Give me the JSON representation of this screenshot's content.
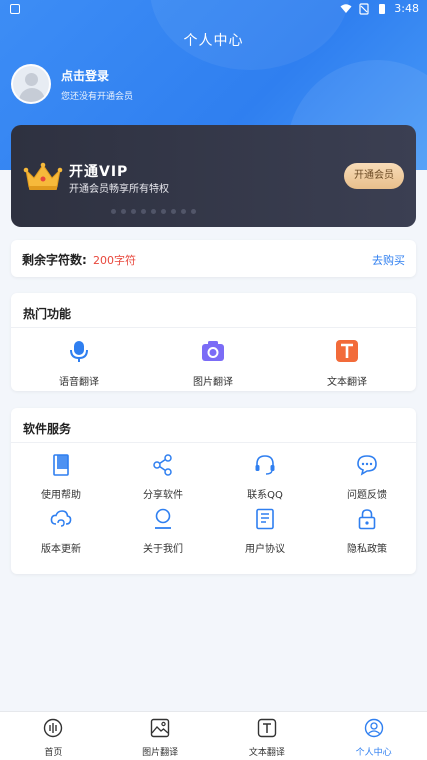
{
  "statusbar": {
    "time": "3:48"
  },
  "header": {
    "title": "个人中心"
  },
  "profile": {
    "login_label": "点击登录",
    "subtitle": "您还没有开通会员"
  },
  "vip": {
    "title": "开通VIP",
    "subtitle": "开通会员畅享所有特权",
    "button_label": "开通会员"
  },
  "chars": {
    "label": "剩余字符数:",
    "value": "200字符",
    "buy_label": "去购买"
  },
  "hot": {
    "title": "热门功能",
    "items": [
      {
        "label": "语音翻译",
        "icon": "microphone-icon"
      },
      {
        "label": "图片翻译",
        "icon": "camera-icon"
      },
      {
        "label": "文本翻译",
        "icon": "text-icon"
      }
    ]
  },
  "service": {
    "title": "软件服务",
    "items": [
      {
        "label": "使用帮助",
        "icon": "book-icon"
      },
      {
        "label": "分享软件",
        "icon": "share-icon"
      },
      {
        "label": "联系QQ",
        "icon": "headset-icon"
      },
      {
        "label": "问题反馈",
        "icon": "chat-bubble-icon"
      },
      {
        "label": "版本更新",
        "icon": "cloud-refresh-icon"
      },
      {
        "label": "关于我们",
        "icon": "person-icon"
      },
      {
        "label": "用户协议",
        "icon": "document-icon"
      },
      {
        "label": "隐私政策",
        "icon": "lock-icon"
      }
    ]
  },
  "tabbar": {
    "items": [
      {
        "label": "首页",
        "icon": "home-icon",
        "active": false
      },
      {
        "label": "图片翻译",
        "icon": "image-icon",
        "active": false
      },
      {
        "label": "文本翻译",
        "icon": "text-icon",
        "active": false
      },
      {
        "label": "个人中心",
        "icon": "profile-icon",
        "active": true
      }
    ]
  },
  "colors": {
    "accent": "#2f7ff0",
    "vip_bg": "#2e3140",
    "price_red": "#e8473c"
  }
}
